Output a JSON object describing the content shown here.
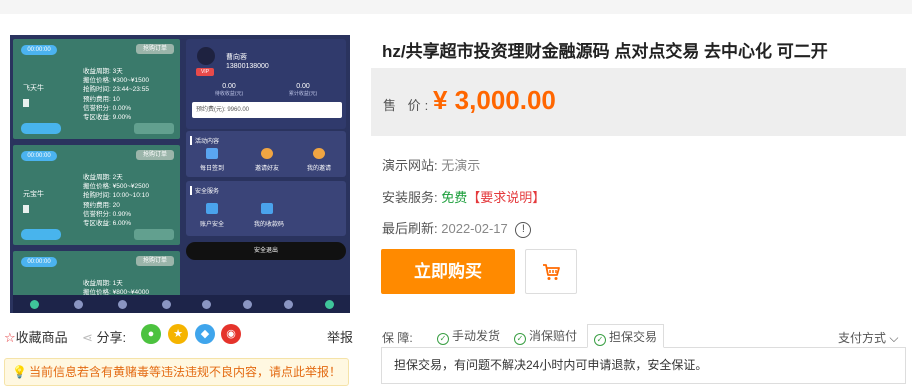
{
  "product": {
    "title": "hz/共享超市投资理财金融源码 点对点交易 去中心化 可二开",
    "price_label": "售 价:",
    "price": "¥ 3,000.00"
  },
  "info": {
    "demo_label": "演示网站:",
    "demo_value": "无演示",
    "install_label": "安装服务:",
    "install_value": "免费",
    "install_req": "【要求说明】",
    "refresh_label": "最后刷新:",
    "refresh_value": "2022-02-17"
  },
  "actions": {
    "buy_label": "立即购买"
  },
  "image_actions": {
    "favorite_label": "收藏商品",
    "share_label": "分享:",
    "report_label": "举报",
    "warning_text": "当前信息若含有黄赌毒等违法违规不良内容，请点此举报！"
  },
  "guarantee": {
    "label": "保 障:",
    "items": [
      "手动发货",
      "消保赔付",
      "担保交易"
    ],
    "payment_label": "支付方式",
    "description": "担保交易，有问题不解决24小时内可申请退款，安全保证。"
  },
  "screenshot_app": {
    "cards": [
      {
        "pill": "00:00:00",
        "tag": "抢购订单",
        "name": "飞天牛",
        "rows": [
          "收益周期: 3天",
          "搬位价格: ¥300~¥1500",
          "抢购时间: 23:44~23:55",
          "预约费用: 10",
          "信誉积分: 0.00%",
          "专区收益: 9.00%"
        ]
      },
      {
        "pill": "00:00:00",
        "tag": "抢购订单",
        "name": "元宝牛",
        "rows": [
          "收益周期: 2天",
          "搬位价格: ¥500~¥2500",
          "抢购时间: 10:00~10:10",
          "预约费用: 20",
          "信誉积分: 0.90%",
          "专区收益: 6.00%"
        ]
      },
      {
        "pill": "00:00:00",
        "tag": "抢购订单",
        "name": "",
        "rows": [
          "收益周期: 1天",
          "搬位价格: ¥800~¥4000"
        ]
      }
    ],
    "profile_name": "曹向蓉",
    "profile_phone": "13800138000",
    "vip": "VIP",
    "stat1_value": "0.00",
    "stat1_label": "待收收益(元)",
    "stat2_value": "0.00",
    "stat2_label": "累计收益(元)",
    "input_text": "预约费(元): 9960.00",
    "activity_title": "活动内容",
    "activity_items": [
      "每日签到",
      "邀请好友",
      "我的邀请"
    ],
    "security_title": "安全服务",
    "security_items": [
      "账户安全",
      "我的收款码"
    ],
    "logout": "安全退出"
  },
  "colors": {
    "price": "#ff6600",
    "buy_button": "#ff8a00",
    "free_text": "#1a9e3a",
    "required_text": "#e4393c",
    "warning_text": "#e36a12",
    "app_background": "#2a335e",
    "card_green": "#3a7a6b"
  },
  "icons": {
    "share": [
      "wechat-icon",
      "qzone-icon",
      "qq-icon",
      "weibo-icon"
    ],
    "cart": "shopping-cart-icon",
    "info": "info-circle-icon",
    "warning": "lightbulb-icon"
  }
}
